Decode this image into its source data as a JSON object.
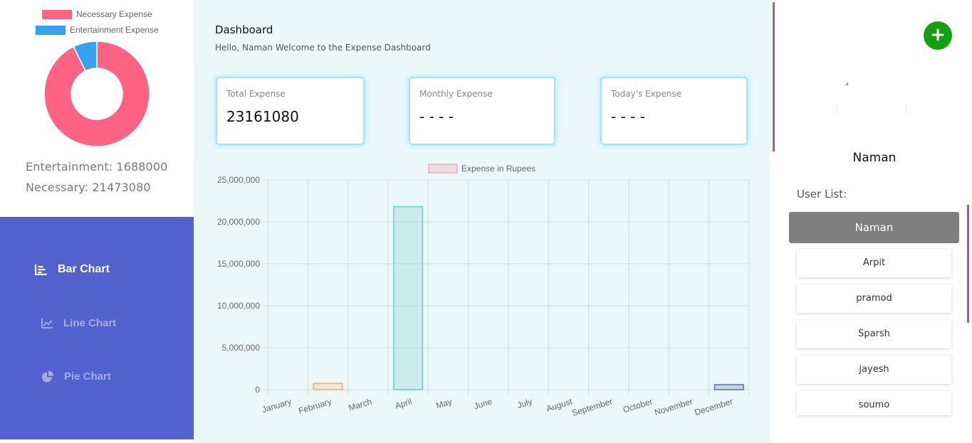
{
  "pie": {
    "legend": [
      {
        "label": "Necessary Expense",
        "color": "#ff6384"
      },
      {
        "label": "Entertainment Expense",
        "color": "#36a2eb"
      }
    ],
    "values": [
      21473080,
      1688000
    ],
    "summary_entertainment": "Entertainment: 1688000",
    "summary_necessary": "Necessary: 21473080"
  },
  "nav": {
    "items": [
      {
        "label": "Bar Chart",
        "icon": "bar-chart-icon",
        "active": true
      },
      {
        "label": "Line Chart",
        "icon": "line-chart-icon",
        "active": false
      },
      {
        "label": "Pie Chart",
        "icon": "pie-chart-icon",
        "active": false
      }
    ]
  },
  "header": {
    "title": "Dashboard",
    "subtitle": "Hello, Naman Welcome to the Expense Dashboard"
  },
  "cards": [
    {
      "title": "Total Expense",
      "value": "23161080"
    },
    {
      "title": "Monthly Expense",
      "value": "- - - -"
    },
    {
      "title": "Today's Expense",
      "value": "- - - -"
    }
  ],
  "chart_data": {
    "type": "bar",
    "legend": "Expense in Rupees",
    "categories": [
      "January",
      "February",
      "March",
      "April",
      "May",
      "June",
      "July",
      "August",
      "September",
      "October",
      "November",
      "December"
    ],
    "values": [
      0,
      750000,
      0,
      21800000,
      0,
      0,
      0,
      0,
      0,
      0,
      0,
      600000
    ],
    "bar_colors": [
      "#ff6384",
      "#ff9f40",
      "#ffcd56",
      "#4bc0c0",
      "#36a2eb",
      "#9966ff",
      "#c9cbcf",
      "#ff6384",
      "#ff9f40",
      "#ffcd56",
      "#4bc0c0",
      "#3b4f9c"
    ],
    "ylim": [
      0,
      25000000
    ],
    "yticks": [
      "0",
      "5,000,000",
      "10,000,000",
      "15,000,000",
      "20,000,000",
      "25,000,000"
    ],
    "ytick_values": [
      0,
      5000000,
      10000000,
      15000000,
      20000000,
      25000000
    ],
    "grid": true
  },
  "right": {
    "add_label": "+",
    "current_user": "Naman",
    "user_list_title": "User List:",
    "selected_user": "Naman",
    "users": [
      "Arpit",
      "pramod",
      "Sparsh",
      "jayesh",
      "soumo"
    ]
  }
}
